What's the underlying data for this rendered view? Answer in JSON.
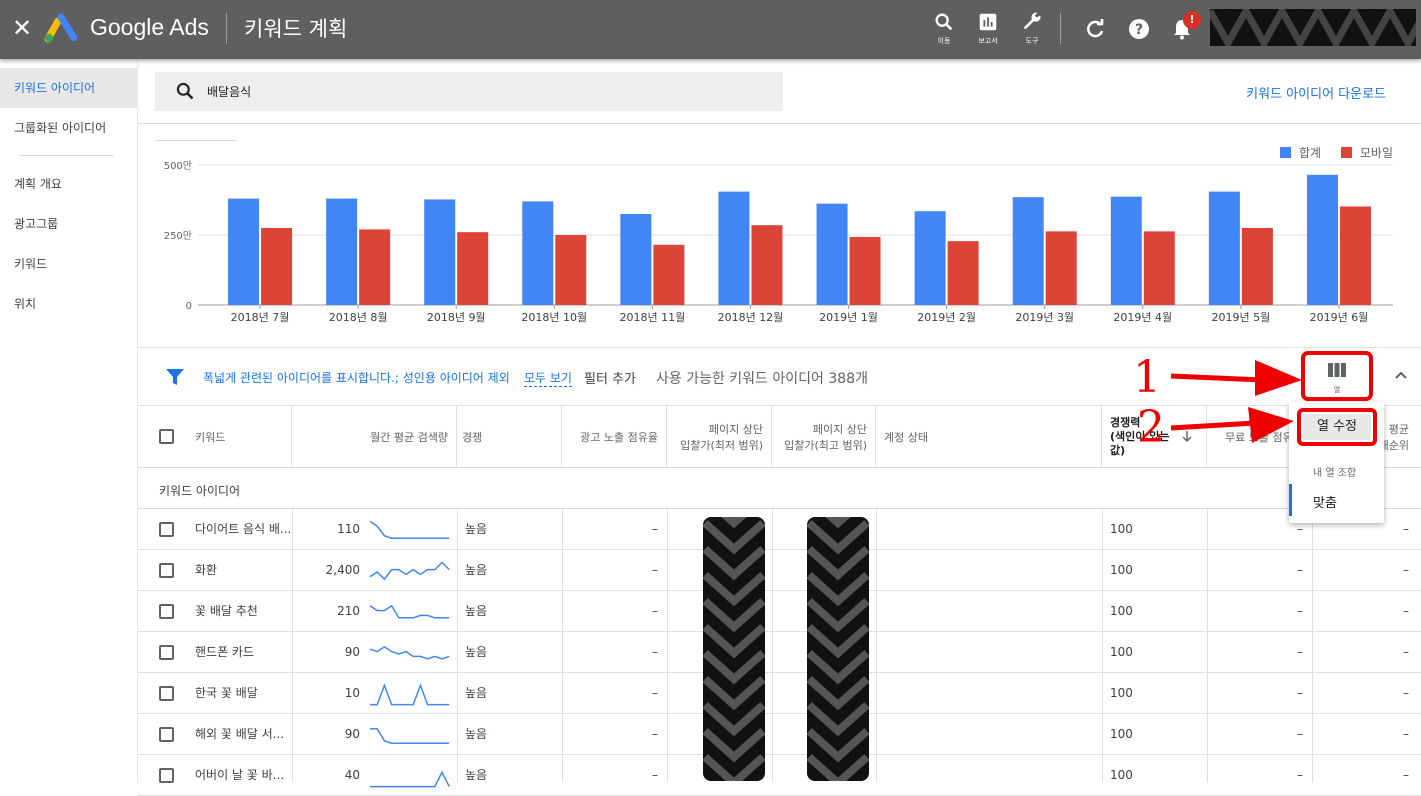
{
  "header": {
    "close_icon": "close-icon",
    "brand": "Google Ads",
    "page_title": "키워드 계획",
    "tools": [
      {
        "label": "이동",
        "icon": "search-icon"
      },
      {
        "label": "보고서",
        "icon": "bar-chart-icon"
      },
      {
        "label": "도구",
        "icon": "wrench-icon"
      }
    ],
    "notification_badge": "!"
  },
  "sidebar": {
    "items": [
      {
        "label": "키워드 아이디어",
        "active": true
      },
      {
        "label": "그룹화된 아이디어"
      },
      {
        "label": "계획 개요"
      },
      {
        "label": "광고그룹"
      },
      {
        "label": "키워드"
      },
      {
        "label": "위치"
      }
    ]
  },
  "search": {
    "value": "배달음식",
    "download_label": "키워드 아이디어 다운로드"
  },
  "chart_data": {
    "type": "bar",
    "categories": [
      "2018년 7월",
      "2018년 8월",
      "2018년 9월",
      "2018년 10월",
      "2018년 11월",
      "2018년 12월",
      "2019년 1월",
      "2019년 2월",
      "2019년 3월",
      "2019년 4월",
      "2019년 5월",
      "2019년 6월"
    ],
    "series": [
      {
        "name": "합계",
        "color": "#4285f4",
        "values": [
          380,
          380,
          377,
          370,
          325,
          405,
          362,
          335,
          385,
          387,
          405,
          465
        ]
      },
      {
        "name": "모바일",
        "color": "#db4437",
        "values": [
          275,
          270,
          260,
          250,
          215,
          285,
          243,
          228,
          263,
          263,
          275,
          352
        ]
      }
    ],
    "ylim": [
      0,
      500
    ],
    "yticks": [
      "0",
      "250만",
      "500만"
    ],
    "grid": true,
    "legend": "top-right"
  },
  "filter": {
    "text": "폭넓게 관련된 아이디어를 표시합니다.; 성인용 아이디어 제외",
    "show_all": "모두 보기",
    "add_filter": "필터 추가",
    "count": "사용 가능한 키워드 아이디어 388개",
    "columns_label": "열"
  },
  "table": {
    "headers": {
      "keyword": "키워드",
      "volume": "월간 평균 검색량",
      "competition": "경쟁",
      "impression_share": "광고 노출 점유율",
      "bid_low_1": "페이지 상단",
      "bid_low_2": "입찰가(최저 범위)",
      "bid_high_1": "페이지 상단",
      "bid_high_2": "입찰가(최고 범위)",
      "account_status": "계정 상태",
      "comp_index_1": "경쟁력",
      "comp_index_2": "(색인이 있는",
      "comp_index_3": "값)",
      "organic_share": "무료 노출 점유율",
      "avg_pos_1": "평균",
      "avg_pos_2": "게재순위"
    },
    "section_label": "키워드 아이디어",
    "rows": [
      {
        "keyword": "다이어트 음식 배...",
        "volume": "110",
        "competition": "높음",
        "share": "–",
        "comp_index": "100",
        "organic": "–",
        "avg": "–"
      },
      {
        "keyword": "화환",
        "volume": "2,400",
        "competition": "높음",
        "share": "–",
        "comp_index": "100",
        "organic": "–",
        "avg": "–"
      },
      {
        "keyword": "꽃 배달 추천",
        "volume": "210",
        "competition": "높음",
        "share": "–",
        "comp_index": "100",
        "organic": "–",
        "avg": "–"
      },
      {
        "keyword": "핸드폰 카드",
        "volume": "90",
        "competition": "높음",
        "share": "–",
        "comp_index": "100",
        "organic": "–",
        "avg": "–"
      },
      {
        "keyword": "한국 꽃 배달",
        "volume": "10",
        "competition": "높음",
        "share": "–",
        "comp_index": "100",
        "organic": "–",
        "avg": "–"
      },
      {
        "keyword": "해외 꽃 배달 서...",
        "volume": "90",
        "competition": "높음",
        "share": "–",
        "comp_index": "100",
        "organic": "–",
        "avg": "–"
      },
      {
        "keyword": "어버이 날 꽃 바...",
        "volume": "40",
        "competition": "높음",
        "share": "–",
        "comp_index": "100",
        "organic": "–",
        "avg": "–"
      }
    ]
  },
  "dropdown": {
    "edit_columns": "열 수정",
    "section_label": "내 열 조합",
    "item": "맞춤"
  },
  "annotations": {
    "one": "1",
    "two": "2"
  }
}
